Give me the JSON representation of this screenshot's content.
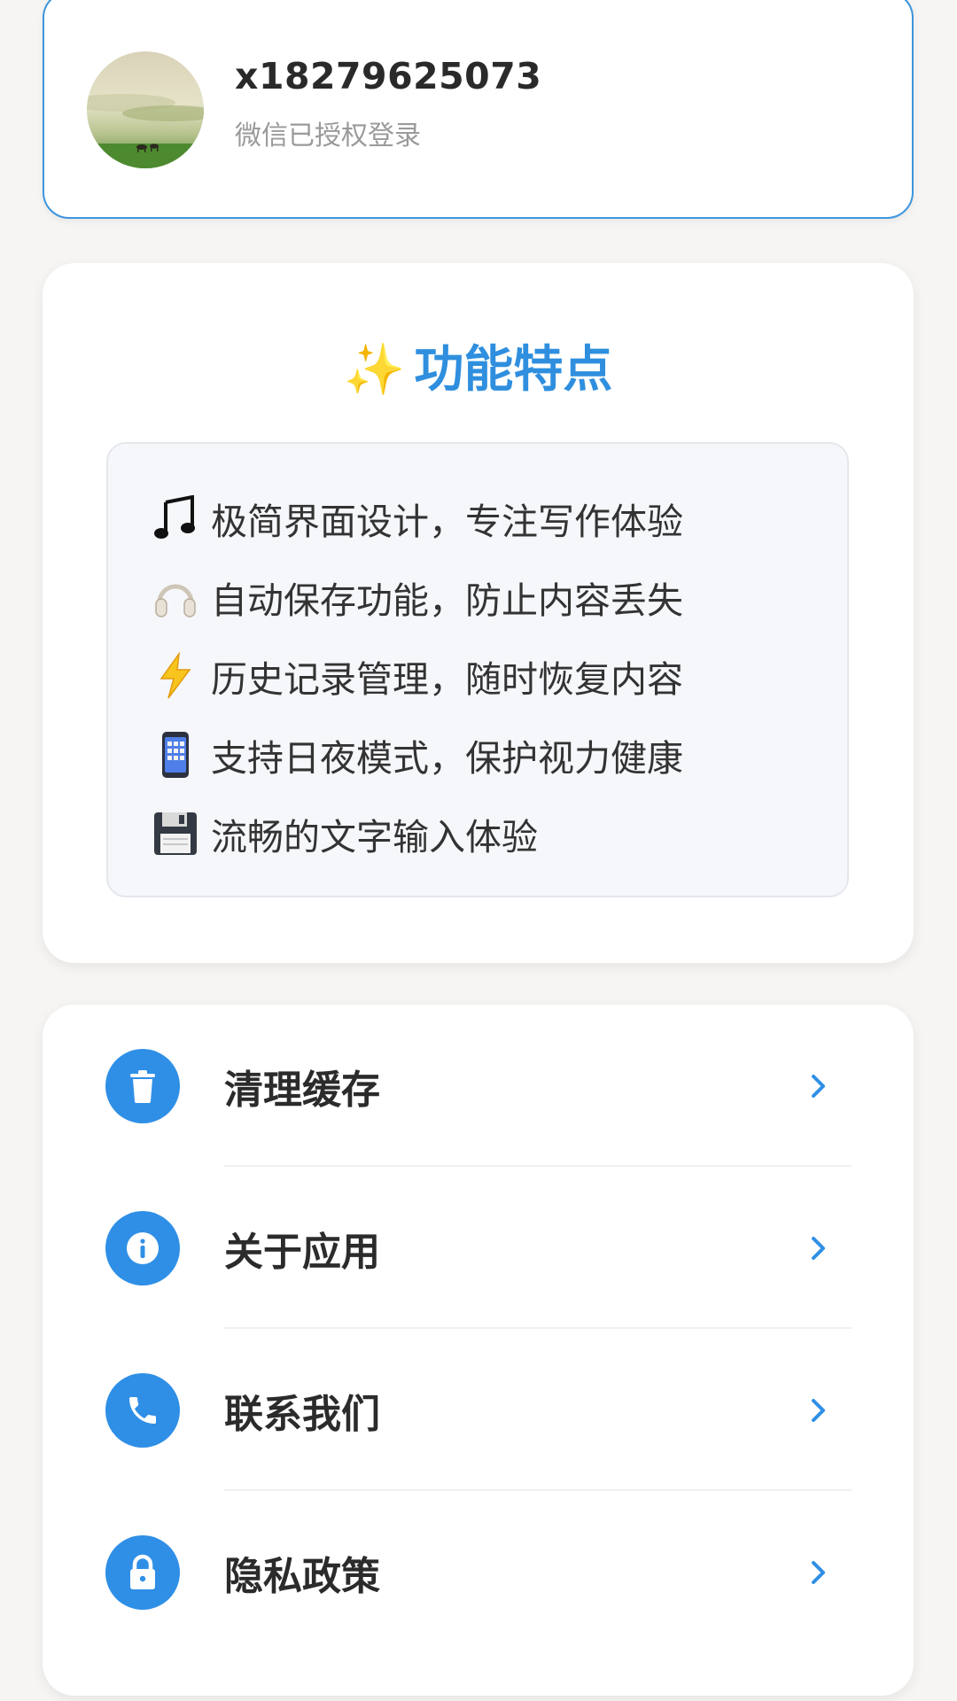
{
  "profile": {
    "username": "x18279625073",
    "login_status": "微信已授权登录",
    "avatar_icon": "landscape-avatar"
  },
  "features": {
    "title_icon": "sparkles-icon",
    "title": "功能特点",
    "items": [
      {
        "icon": "music-note-icon",
        "text": "极简界面设计，专注写作体验"
      },
      {
        "icon": "headphones-icon",
        "text": "自动保存功能，防止内容丢失"
      },
      {
        "icon": "lightning-icon",
        "text": "历史记录管理，随时恢复内容"
      },
      {
        "icon": "mobile-phone-icon",
        "text": "支持日夜模式，保护视力健康"
      },
      {
        "icon": "floppy-disk-icon",
        "text": "流畅的文字输入体验"
      }
    ]
  },
  "menu": {
    "items": [
      {
        "icon": "trash-icon",
        "label": "清理缓存"
      },
      {
        "icon": "info-icon",
        "label": "关于应用"
      },
      {
        "icon": "phone-icon",
        "label": "联系我们"
      },
      {
        "icon": "lock-icon",
        "label": "隐私政策"
      }
    ]
  },
  "colors": {
    "accent": "#2f8fe6",
    "title": "#2f8fde",
    "background": "#f6f5f3"
  }
}
